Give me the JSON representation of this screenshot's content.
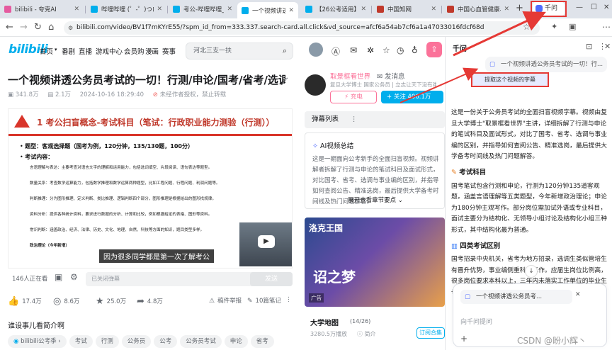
{
  "browser": {
    "tabs": [
      {
        "title": "bilibili - 夸克AI",
        "color": "#e55a9f"
      },
      {
        "title": "哔哩哔哩 (゜-゜)つロ 干杯",
        "color": "#00aeec"
      },
      {
        "title": "考公-哔哩哔哩_bilibili",
        "color": "#00aeec"
      },
      {
        "title": "一个视频讲透公务员考试",
        "color": "#00aeec"
      },
      {
        "title": "【26公考适用】政治理论",
        "color": "#00aeec"
      },
      {
        "title": "中国知网",
        "color": "#c0392b"
      },
      {
        "title": "中国心血管健康与疾病",
        "color": "#c0392b"
      }
    ],
    "new_tab": "+",
    "doubao_button": "千问",
    "url": "bilibili.com/video/BV1f7mKYrE55/?spm_id_from=333.337.search-card.all.click&vd_source=afcf6a54ab7cf6a1a47033016fdcf68d"
  },
  "bili": {
    "logo": "bilibili",
    "menu": [
      "首页",
      "番剧",
      "直播",
      "游戏中心",
      "会员购",
      "漫画",
      "赛事"
    ],
    "search_placeholder": "河北三支一扶",
    "video_title": "一个视频讲透公务员考试的一切！行测/申论/国考/省考/选调/事业编/...",
    "meta": {
      "views": "341.8万",
      "danmaku": "2.1万",
      "date": "2024-10-16 18:29:40",
      "rights": "未经作者授权，禁止转载"
    },
    "slide": {
      "heading": "1 考公扫盲概念-考试科目（笔试：行政职业能力测验（行测））",
      "bullets": [
        "题型：客观选择题（国考为例，120分钟，135/130题，100分）",
        "考试内容："
      ],
      "lines": [
        "言语理解与表达：主要考查对语言文字的理解和运用能力，包括选词填空、片段阅读、语句表达等题型。",
        "数量关系：考查数学运算能力，包括数学推理和数学运算两种题型，比如工程问题、行程问题、利润问题等。",
        "判断推理：分为图形推理、定义判断、类比推理、逻辑判断四个部分，图形推理是根据给出的图形找规律。",
        "资料分析：提供各种统计资料，要求进行数据的分析、计算和比较，例如根据给定的表格、图形等资料。",
        "常识判断：涵盖政治、经济、法律、历史、文化、地理、自然、科技等方面的知识，题目类型多样。",
        "政治理论（今年新增）"
      ],
      "subtitle": "因为很多同学都是第一次了解考公"
    },
    "player_bar": {
      "watching": "146人正在看",
      "danmaku_placeholder": "已关闭弹幕",
      "send": "发送"
    },
    "actions": {
      "like": "17.4万",
      "coin": "8.6万",
      "fav": "25.0万",
      "share": "4.8万",
      "report": "稿件举报",
      "notes": "10篇笔记"
    },
    "friend_title": "谁设事儿看简介啊",
    "tags": [
      "bilibili公考季",
      "考试",
      "行测",
      "公务员",
      "公考",
      "公务员考试",
      "申论",
      "省考"
    ],
    "up": {
      "name": "取景框看世界",
      "msg": "发消息",
      "desc": "复旦大学博士 国家公务员 | 立志让天下没有难考的公",
      "charge": "充电",
      "follow": "+ 关注 406.1万"
    },
    "danmu_list": "弹幕列表",
    "ai_summary": {
      "title": "AI视频总结",
      "body": "这是一期面向公考新手的全面扫盲视频。视频讲解者拆解了行测与申论的笔试科目及面试形式，对比国考、省考、选调与事业编的区别，并指导如何查阅公告、精准选岗，最后提供大学备考时间线及热门问题解答。",
      "more": "展开查看章节要点"
    },
    "ad": {
      "title": "洛克王国",
      "game": "诏之梦",
      "tag": "广告"
    },
    "map": {
      "title": "大学地图",
      "count": "(14/26)",
      "plays": "3280.5万播放",
      "brief": "简介",
      "sub": "订阅合集"
    }
  },
  "doubao": {
    "title": "千问",
    "query_card": "一个视频讲透公务员考试的一切！行...",
    "subtitle_btn": "提取这个视频的字幕",
    "answer": {
      "intro": "这是一份关于公务员考试的全面扫盲视频字幕。视频由复旦大学博士\"取景框看世界\"主讲，详细拆解了行测与申论的笔试科目及面试形式，对比了国考、省考、选调与事业编的区别，并指导如何查阅公告、精准选岗，最后提供大学备考时间线及热门问题解答。",
      "sec1": "考试科目",
      "sec1_body": "国考笔试包含行测和申论，行测为120分钟135道客观题，涵盖言语理解等五类题型，今年新增政治理论；申论为180分钟主观写作。部分岗位需加试外语或专业科目，面试主要分为结构化、无领导小组讨论及结构化小组三种形式，其中结构化最为普通。",
      "sec2": "四类考试区别",
      "sec2_body": "国考招录中央机关，省考为地方招录，选调生类似管培生有晋升优势，事业编侧重科室工作。应届生岗位比例高，很多岗位要求本科以上，三年内未落实工作单位的毕业生也可报考。"
    },
    "chip": "一个视频讲透公务员考...",
    "ask_placeholder": "向千问提问",
    "watermark": "CSDN @盼小辉丶"
  }
}
